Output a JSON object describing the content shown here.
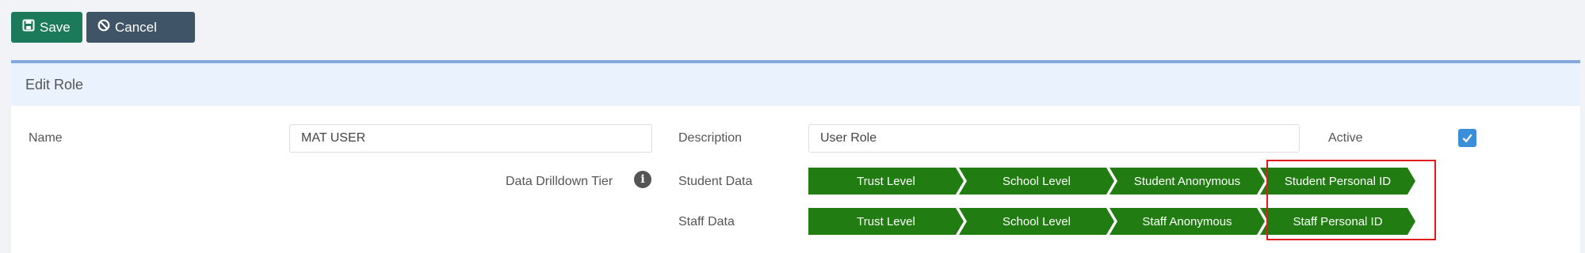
{
  "toolbar": {
    "save_label": "Save",
    "cancel_label": "Cancel"
  },
  "panel": {
    "title": "Edit Role"
  },
  "form": {
    "name_label": "Name",
    "name_value": "MAT USER",
    "description_label": "Description",
    "description_value": "User Role",
    "active_label": "Active",
    "active_checked": true,
    "drilldown_label": "Data Drilldown Tier",
    "student_data_label": "Student Data",
    "staff_data_label": "Staff Data",
    "student_tiers": [
      "Trust Level",
      "School Level",
      "Student Anonymous",
      "Student Personal ID"
    ],
    "staff_tiers": [
      "Trust Level",
      "School Level",
      "Staff Anonymous",
      "Staff Personal ID"
    ]
  },
  "colors": {
    "save": "#1b7a5a",
    "cancel": "#3f5466",
    "tier": "#217d12",
    "highlight": "#e01b1b",
    "checkbox": "#3b8fd8"
  },
  "icons": [
    "save-icon",
    "cancel-icon",
    "info-icon",
    "checkmark-icon"
  ]
}
